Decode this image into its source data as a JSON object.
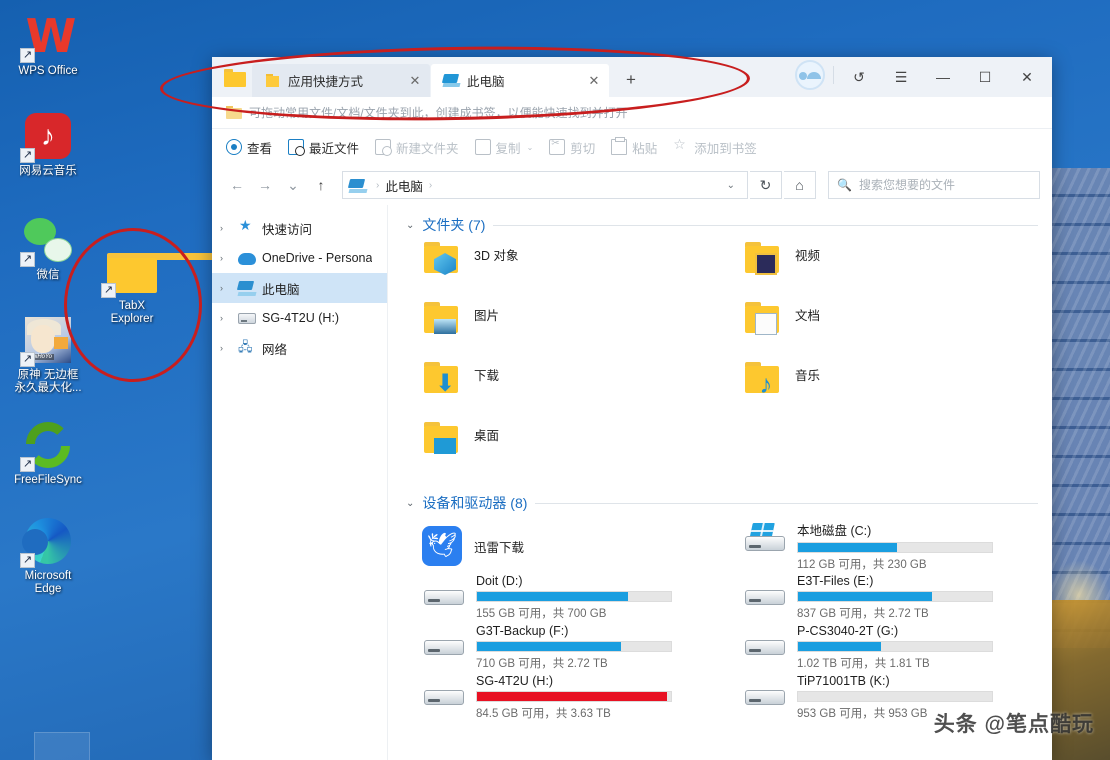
{
  "desktop": {
    "icons": [
      {
        "label": "WPS Office",
        "icon": "wps-office-icon",
        "shortcut": true
      },
      {
        "label": "网易云音乐",
        "icon": "netease-music-icon",
        "shortcut": true
      },
      {
        "label": "微信",
        "icon": "wechat-icon",
        "shortcut": true
      },
      {
        "label": "原神 无边框\n永久最大化...",
        "icon": "genshin-icon",
        "shortcut": true
      },
      {
        "label": "FreeFileSync",
        "icon": "freefilesync-icon",
        "shortcut": true
      },
      {
        "label": "Microsoft\nEdge",
        "icon": "microsoft-edge-icon",
        "shortcut": true
      }
    ],
    "highlighted_icon": {
      "label": "TabX\nExplorer",
      "icon": "folder-icon",
      "shortcut": true
    }
  },
  "window": {
    "tabs": [
      {
        "label": "应用快捷方式",
        "icon": "folder-icon",
        "active": false,
        "close": "✕"
      },
      {
        "label": "此电脑",
        "icon": "this-pc-icon",
        "active": true,
        "close": "✕"
      }
    ],
    "new_tab_label": "+",
    "controls": {
      "undo": "↺",
      "menu": "☰",
      "minimize": "—",
      "maximize": "☐",
      "close": "✕"
    },
    "bookmark_hint": "可拖动常用文件/文档/文件夹到此，创建成书签，以便能快速找到并打开",
    "commands": [
      {
        "label": "查看",
        "icon": "eye-icon",
        "disabled": false,
        "caret": ""
      },
      {
        "label": "最近文件",
        "icon": "recent-file-icon",
        "disabled": false,
        "caret": ""
      },
      {
        "label": "新建文件夹",
        "icon": "new-folder-icon",
        "disabled": true,
        "caret": ""
      },
      {
        "label": "复制",
        "icon": "copy-icon",
        "disabled": true,
        "caret": "⌄"
      },
      {
        "label": "剪切",
        "icon": "cut-icon",
        "disabled": true,
        "caret": ""
      },
      {
        "label": "粘贴",
        "icon": "paste-icon",
        "disabled": true,
        "caret": ""
      },
      {
        "label": "添加到书签",
        "icon": "bookmark-star-icon",
        "disabled": true,
        "caret": ""
      }
    ],
    "address": {
      "back": "←",
      "forward": "→",
      "history": "⌄",
      "up": "↑",
      "crumb_icon": "this-pc-icon",
      "crumb": "此电脑",
      "crumb_sep": "›",
      "dropdown": "⌄",
      "refresh": "↻",
      "home": "⌂"
    },
    "search": {
      "placeholder": "搜索您想要的文件",
      "value": "",
      "icon": "search-icon"
    }
  },
  "sidebar": {
    "items": [
      {
        "label": "快速访问",
        "icon": "star-icon",
        "chev": "›",
        "selected": false
      },
      {
        "label": "OneDrive - Persona",
        "icon": "cloud-icon",
        "chev": "›",
        "selected": false
      },
      {
        "label": "此电脑",
        "icon": "this-pc-icon",
        "chev": "›",
        "selected": true
      },
      {
        "label": "SG-4T2U (H:)",
        "icon": "drive-icon",
        "chev": "›",
        "selected": false
      },
      {
        "label": "网络",
        "icon": "network-icon",
        "chev": "›",
        "selected": false
      }
    ]
  },
  "content": {
    "folders_group": {
      "chev": "⌄",
      "title": "文件夹 (7)"
    },
    "folders": [
      {
        "name": "3D 对象",
        "icon": "folder-3d-objects-icon"
      },
      {
        "name": "视频",
        "icon": "folder-videos-icon"
      },
      {
        "name": "图片",
        "icon": "folder-pictures-icon"
      },
      {
        "name": "文档",
        "icon": "folder-documents-icon"
      },
      {
        "name": "下载",
        "icon": "folder-downloads-icon"
      },
      {
        "name": "音乐",
        "icon": "folder-music-icon"
      },
      {
        "name": "桌面",
        "icon": "folder-desktop-icon"
      }
    ],
    "devices_group": {
      "chev": "⌄",
      "title": "设备和驱动器 (8)"
    },
    "app_entry": {
      "name": "迅雷下载",
      "icon": "thunder-download-icon"
    },
    "drives": [
      {
        "name": "本地磁盘 (C:)",
        "sub": "112 GB 可用，共 230 GB",
        "used_pct": 51,
        "bar_color": "#1a9ee0",
        "icon": "windows-drive-icon",
        "column": "right"
      },
      {
        "name": "Doit (D:)",
        "sub": "155 GB 可用，共 700 GB",
        "used_pct": 78,
        "bar_color": "#1a9ee0",
        "icon": "drive-icon",
        "column": "left"
      },
      {
        "name": "E3T-Files (E:)",
        "sub": "837 GB 可用，共 2.72 TB",
        "used_pct": 69,
        "bar_color": "#1a9ee0",
        "icon": "drive-icon",
        "column": "right"
      },
      {
        "name": "G3T-Backup (F:)",
        "sub": "710 GB 可用，共 2.72 TB",
        "used_pct": 74,
        "bar_color": "#1a9ee0",
        "icon": "drive-icon",
        "column": "left"
      },
      {
        "name": "P-CS3040-2T (G:)",
        "sub": "1.02 TB 可用，共 1.81 TB",
        "used_pct": 43,
        "bar_color": "#1a9ee0",
        "icon": "drive-icon",
        "column": "right"
      },
      {
        "name": "SG-4T2U (H:)",
        "sub": "84.5 GB 可用，共 3.63 TB",
        "used_pct": 98,
        "bar_color": "#e81123",
        "icon": "drive-icon",
        "column": "left"
      },
      {
        "name": "TiP71001TB (K:)",
        "sub": "953 GB 可用，共 953 GB",
        "used_pct": 0,
        "bar_color": "#1a9ee0",
        "icon": "drive-icon",
        "column": "right"
      }
    ]
  },
  "watermark": "头条 @笔点酷玩",
  "colors": {
    "accent_blue": "#1a9ee0",
    "alert_red": "#e81123",
    "group_title": "#1b6ec2",
    "selection": "#cfe4f7",
    "annotation_red": "#c81e1e"
  }
}
